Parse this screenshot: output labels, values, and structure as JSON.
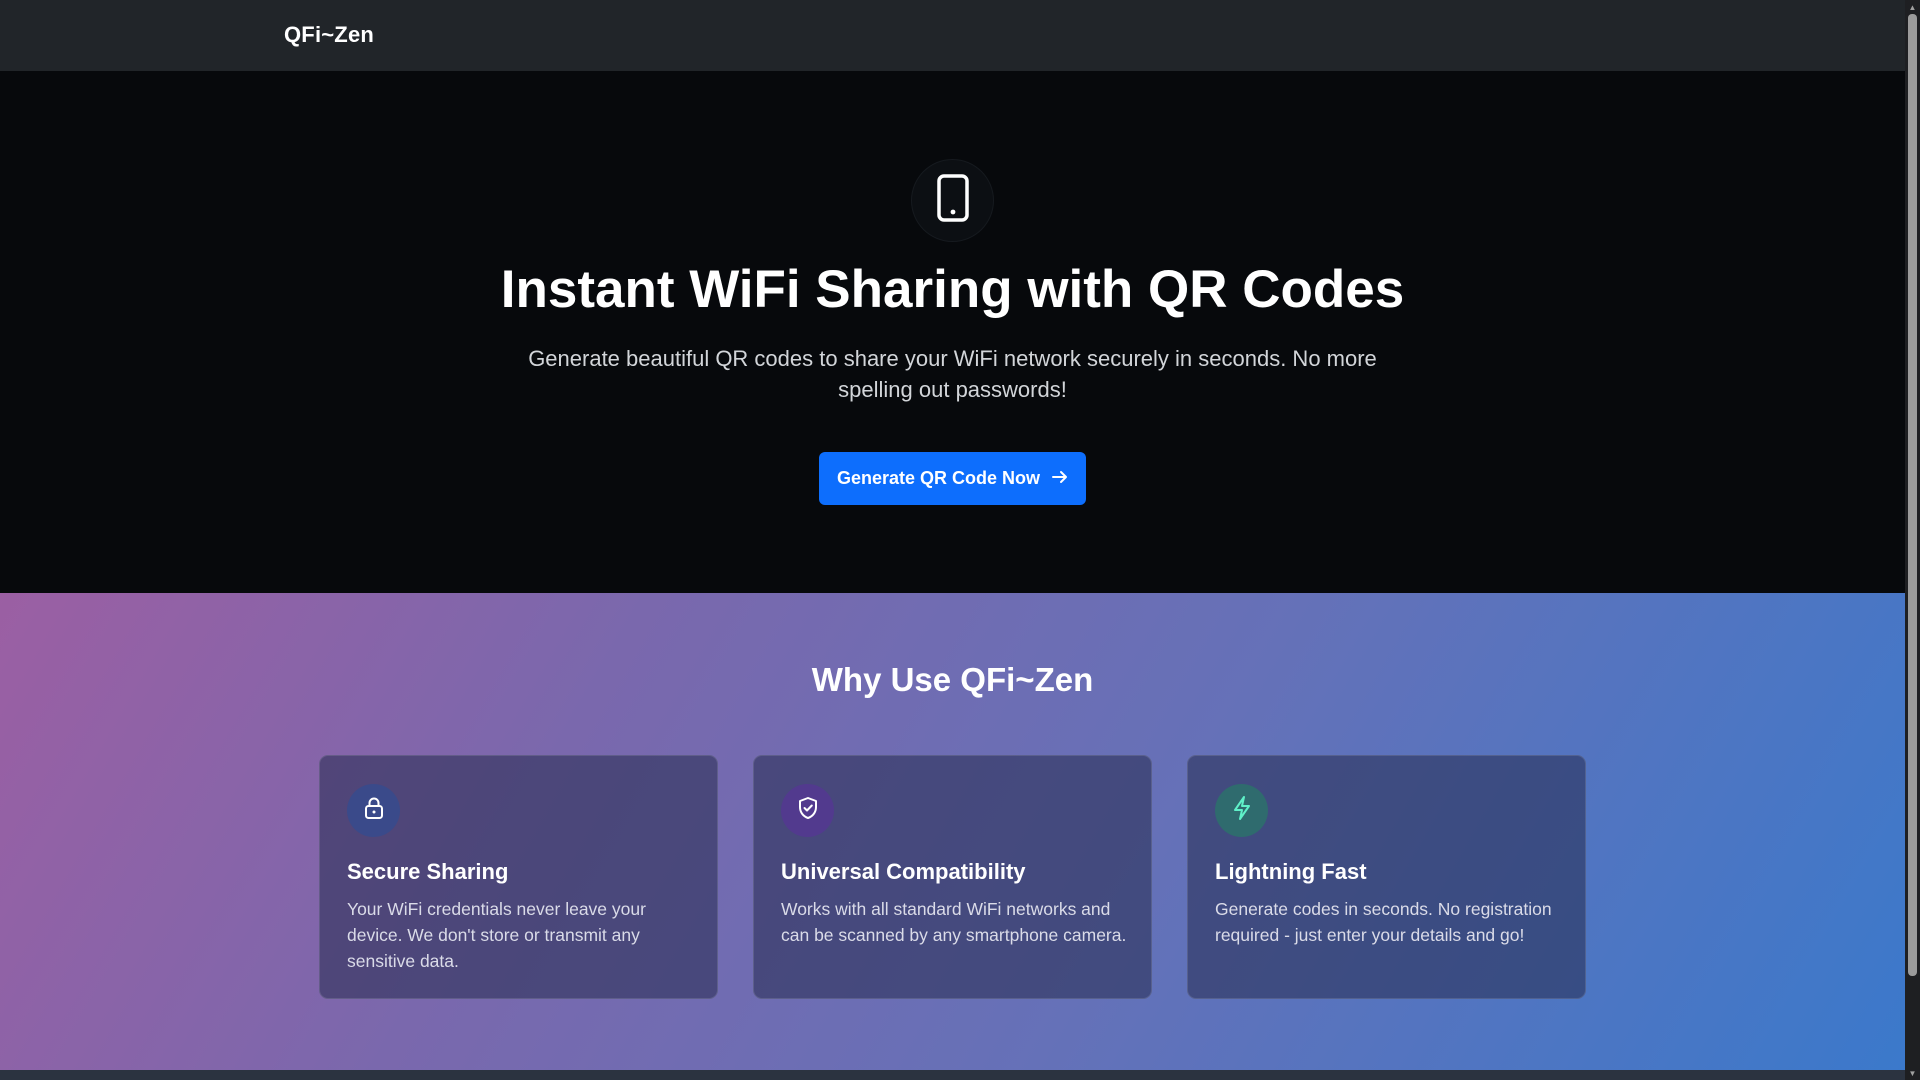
{
  "nav": {
    "brand": "QFi~Zen"
  },
  "hero": {
    "icon": "smartphone-icon",
    "title": "Instant WiFi Sharing with QR Codes",
    "subtitle": "Generate beautiful QR codes to share your WiFi network securely in seconds. No more spelling out passwords!",
    "cta_label": "Generate QR Code Now",
    "cta_icon": "arrow-right-icon"
  },
  "features": {
    "title": "Why Use QFi~Zen",
    "cards": [
      {
        "icon": "lock-icon",
        "title": "Secure Sharing",
        "text": "Your WiFi credentials never leave your device. We don't store or transmit any sensitive data."
      },
      {
        "icon": "shield-check-icon",
        "title": "Universal Compatibility",
        "text": "Works with all standard WiFi networks and can be scanned by any smartphone camera."
      },
      {
        "icon": "lightning-icon",
        "title": "Lightning Fast",
        "text": "Generate codes in seconds. No registration required - just enter your details and go!"
      }
    ]
  },
  "colors": {
    "navbar_bg": "#212529",
    "hero_bg": "#07090c",
    "primary_button": "#0d6efd",
    "gradient_start": "#9b5fa3",
    "gradient_end": "#3b79cb",
    "lock_icon_bg": "#3a4a8a",
    "shield_icon_bg": "#523a8e",
    "lightning_icon_bg": "#2f6b6e"
  }
}
